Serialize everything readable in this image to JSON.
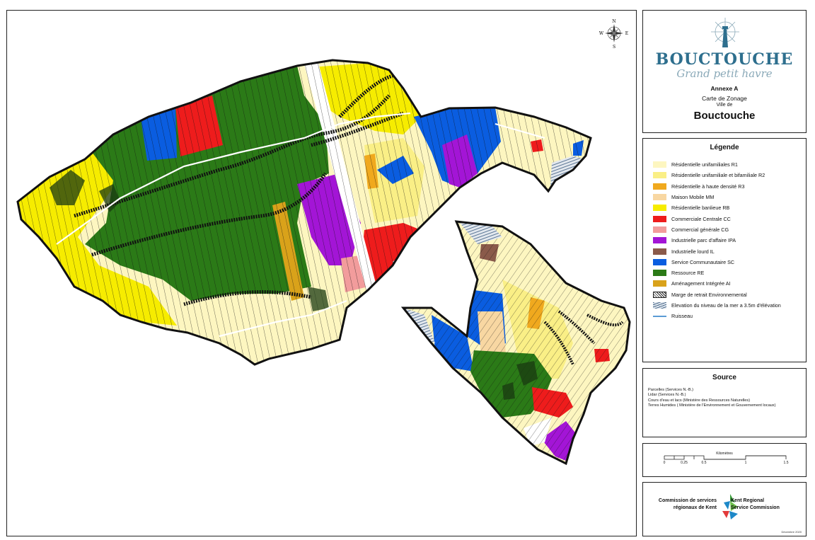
{
  "map": {
    "compass": {
      "n": "N",
      "s": "S",
      "e": "E",
      "w": "W"
    },
    "colors": {
      "R1": "#fdf6c0",
      "R2": "#faef86",
      "R3": "#f0a91e",
      "MM": "#f8d7a2",
      "RB": "#f6ec00",
      "CC": "#ee1c1c",
      "CG": "#f29c9c",
      "IPA": "#a315d6",
      "IL": "#8a5a4a",
      "SC": "#0a5de0",
      "RE": "#2b7a17",
      "AI": "#d9a21a",
      "parcel": "#111111"
    }
  },
  "title": {
    "logo_word": "BOUCTOUCHE",
    "logo_tagline": "Grand petit havre",
    "annexe": "Annexe A",
    "carte": "Carte de Zonage",
    "ville_de": "Ville de",
    "town": "Bouctouche"
  },
  "legend": {
    "heading": "Légende",
    "items": [
      {
        "label": "Résidentielle unifamiliales R1",
        "color": "#fdf6c0"
      },
      {
        "label": "Résidentielle unifamiliale et bifamiliale R2",
        "color": "#faef86"
      },
      {
        "label": "Résidentielle à haute densité R3",
        "color": "#f0a91e"
      },
      {
        "label": "Maison Mobile MM",
        "color": "#f8d7a2"
      },
      {
        "label": "Résidentielle banlieue RB",
        "color": "#f6ec00"
      },
      {
        "label": "Commerciale Centrale CC",
        "color": "#ee1c1c"
      },
      {
        "label": "Commercial générale CG",
        "color": "#f29c9c"
      },
      {
        "label": "Industrielle parc d'affaire IPA",
        "color": "#a315d6"
      },
      {
        "label": "Industrielle lourd IL",
        "color": "#8a5a4a"
      },
      {
        "label": "Service Communautaire SC",
        "color": "#0a5de0"
      },
      {
        "label": "Ressource RE",
        "color": "#2b7a17"
      },
      {
        "label": "Aménagement Intégrée AI",
        "color": "#d9a21a"
      },
      {
        "label": "Marge de retrait Environnemental",
        "color": "",
        "pattern": "hatch"
      },
      {
        "label": "Elevation du niveau de la mer a 3.5m d'élévation",
        "color": "",
        "pattern": "wave"
      },
      {
        "label": "Ruisseau",
        "color": "#5b9bd5",
        "pattern": "line"
      }
    ]
  },
  "source": {
    "heading": "Source",
    "items": [
      "Parcelles (Services N.-B.)",
      "Lidar (Services N.-B.)",
      "Cours d'eau et lacs (Ministère des Ressources Naturelles)",
      "Terres Humides ( Ministère de l'Environnement et Gouvernement locaux)"
    ]
  },
  "scale": {
    "title": "Kilomètres",
    "labels": [
      "0",
      "0.25",
      "0.5",
      "1",
      "1.5"
    ]
  },
  "org": {
    "name_fr_1": "Commission de services",
    "name_fr_2": "régionaux de Kent",
    "name_en_1": "Kent Regional",
    "name_en_2": "Service Commission",
    "date": "Décembre 2020"
  }
}
